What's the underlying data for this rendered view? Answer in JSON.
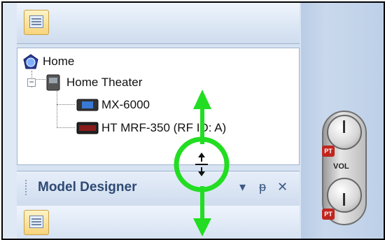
{
  "tree": {
    "items": [
      {
        "label": "Home"
      },
      {
        "label": "Home Theater"
      },
      {
        "label": "MX-6000"
      },
      {
        "label": "HT MRF-350 (RF ID: A)"
      }
    ],
    "expander": "−"
  },
  "panel": {
    "title": "Model Designer",
    "dropdown_glyph": "▾",
    "pin_glyph": "ᵽ",
    "close_glyph": "✕"
  },
  "remote": {
    "vol_label": "VOL",
    "badge": "PT"
  },
  "colors": {
    "highlight": "#22dd22",
    "cursor_arrow": "#22dd22"
  },
  "icons": [
    "toolbar-icon",
    "home-globe-icon",
    "home-theater-icon",
    "device-icon",
    "resize-cursor-icon",
    "arrow-up-icon",
    "arrow-down-icon",
    "pin-icon",
    "close-icon"
  ]
}
